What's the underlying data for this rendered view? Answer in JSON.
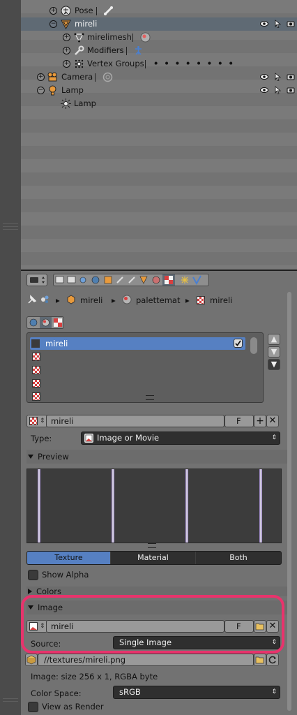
{
  "outliner": {
    "rows": [
      {
        "label": "Pose"
      },
      {
        "label": "mireli"
      },
      {
        "label": "mirelimesh"
      },
      {
        "label": "Modifiers"
      },
      {
        "label": "Vertex Groups"
      },
      {
        "label": "Camera"
      },
      {
        "label": "Lamp"
      },
      {
        "label": "Lamp"
      }
    ],
    "vertex_dots": "••••••••"
  },
  "breadcrumb": {
    "object": "mireli",
    "material": "palettemat",
    "texture": "mireli"
  },
  "slots": {
    "items": [
      "mireli",
      "",
      "",
      "",
      "",
      ""
    ]
  },
  "datablock": {
    "name": "mireli",
    "fake_user": "F"
  },
  "type_row": {
    "label": "Type:",
    "value": "Image or Movie"
  },
  "preview": {
    "title": "Preview",
    "tabs": [
      "Texture",
      "Material",
      "Both"
    ],
    "active_tab": "Texture",
    "show_alpha": "Show Alpha"
  },
  "colors": {
    "title": "Colors"
  },
  "image": {
    "title": "Image",
    "name": "mireli",
    "fake_user": "F",
    "source_label": "Source:",
    "source_value": "Single Image",
    "filepath": "//textures/mireli.png",
    "info": "Image: size 256 x 1, RGBA byte",
    "colorspace_label": "Color Space:",
    "colorspace_value": "sRGB",
    "view_as_render": "View as Render"
  },
  "colors_hex": {
    "accent": "#5680c2",
    "highlight": "#e8336c",
    "selected_row": "#5f6a74"
  }
}
